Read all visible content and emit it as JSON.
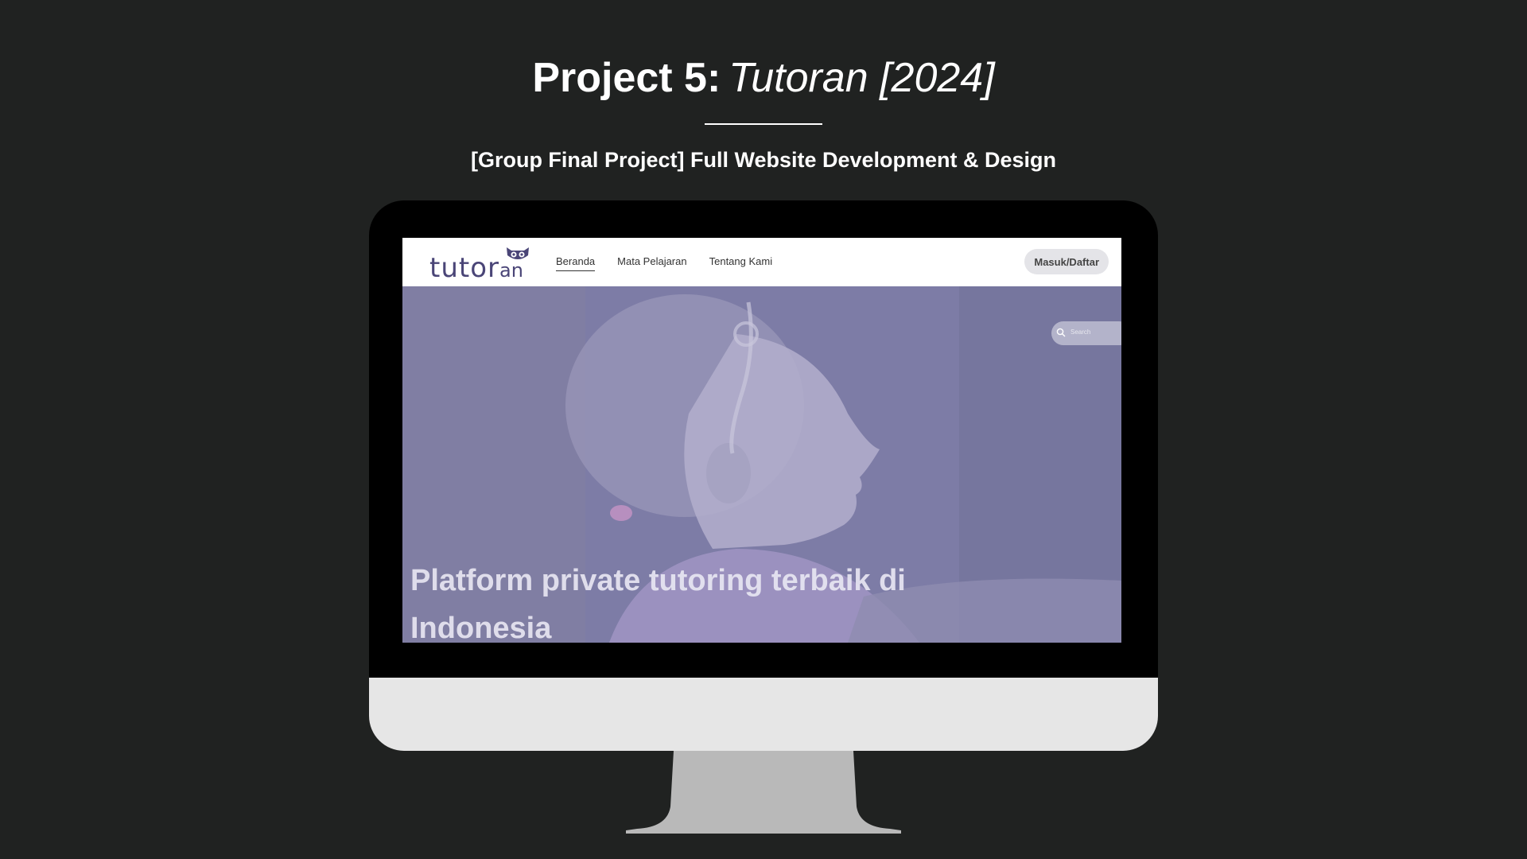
{
  "slide": {
    "title_bold": "Project 5:",
    "title_italic": "Tutoran [2024]",
    "subtitle": "[Group Final Project] Full Website Development & Design"
  },
  "website": {
    "logo_main": "tutor",
    "logo_suffix": "an",
    "nav": {
      "items": [
        {
          "label": "Beranda",
          "active": true
        },
        {
          "label": "Mata Pelajaran",
          "active": false
        },
        {
          "label": "Tentang Kami",
          "active": false
        }
      ],
      "login_label": "Masuk/Daftar"
    },
    "search": {
      "placeholder": "Search"
    },
    "hero": {
      "headline_line1": "Platform private tutoring terbaik di",
      "headline_line2": "Indonesia"
    }
  },
  "colors": {
    "background": "#202221",
    "brand": "#4a4577",
    "hero_overlay": "#8684ad",
    "monitor_chin": "#e6e6e6"
  }
}
